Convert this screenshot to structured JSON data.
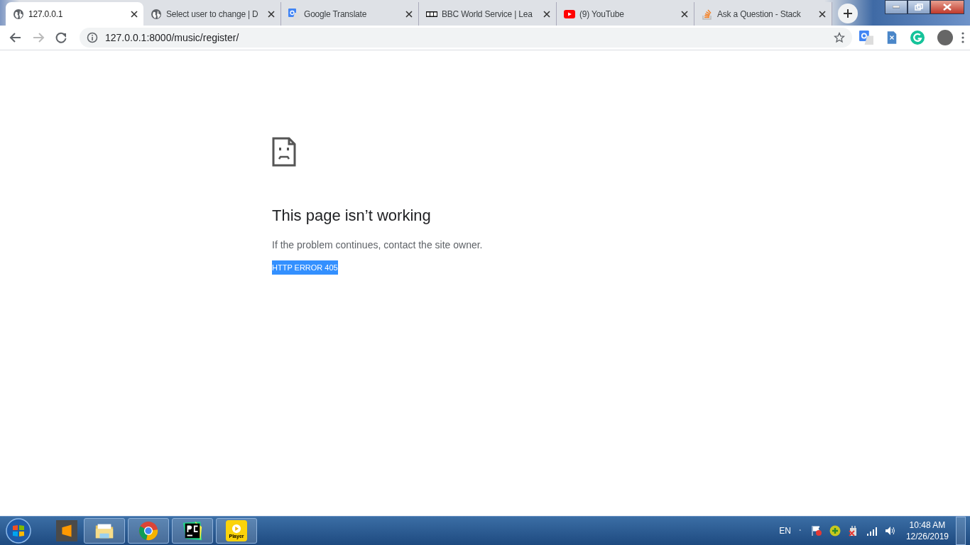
{
  "tabs": [
    {
      "title": "127.0.0.1",
      "kind": "globe",
      "selected": true
    },
    {
      "title": "Select user to change | D",
      "kind": "globe",
      "selected": false
    },
    {
      "title": "Google Translate",
      "kind": "translate",
      "selected": false
    },
    {
      "title": "BBC World Service | Lea",
      "kind": "bbc",
      "selected": false
    },
    {
      "title": "(9) YouTube",
      "kind": "youtube",
      "selected": false
    },
    {
      "title": "Ask a Question - Stack",
      "kind": "stack",
      "selected": false
    }
  ],
  "address_bar": {
    "url": "127.0.0.1:8000/music/register/"
  },
  "error": {
    "title": "This page isn’t working",
    "message": "If the problem continues, contact the site owner.",
    "code": {
      "text": "HTTP ERROR 405",
      "selected": true
    }
  },
  "taskbar": {
    "apps": [
      {
        "kind": "sublime"
      },
      {
        "kind": "folder"
      },
      {
        "kind": "chrome"
      },
      {
        "kind": "pycharm"
      },
      {
        "kind": "player",
        "label": "Player"
      }
    ],
    "language": "EN",
    "time": "10:48 AM",
    "date": "12/26/2019"
  }
}
